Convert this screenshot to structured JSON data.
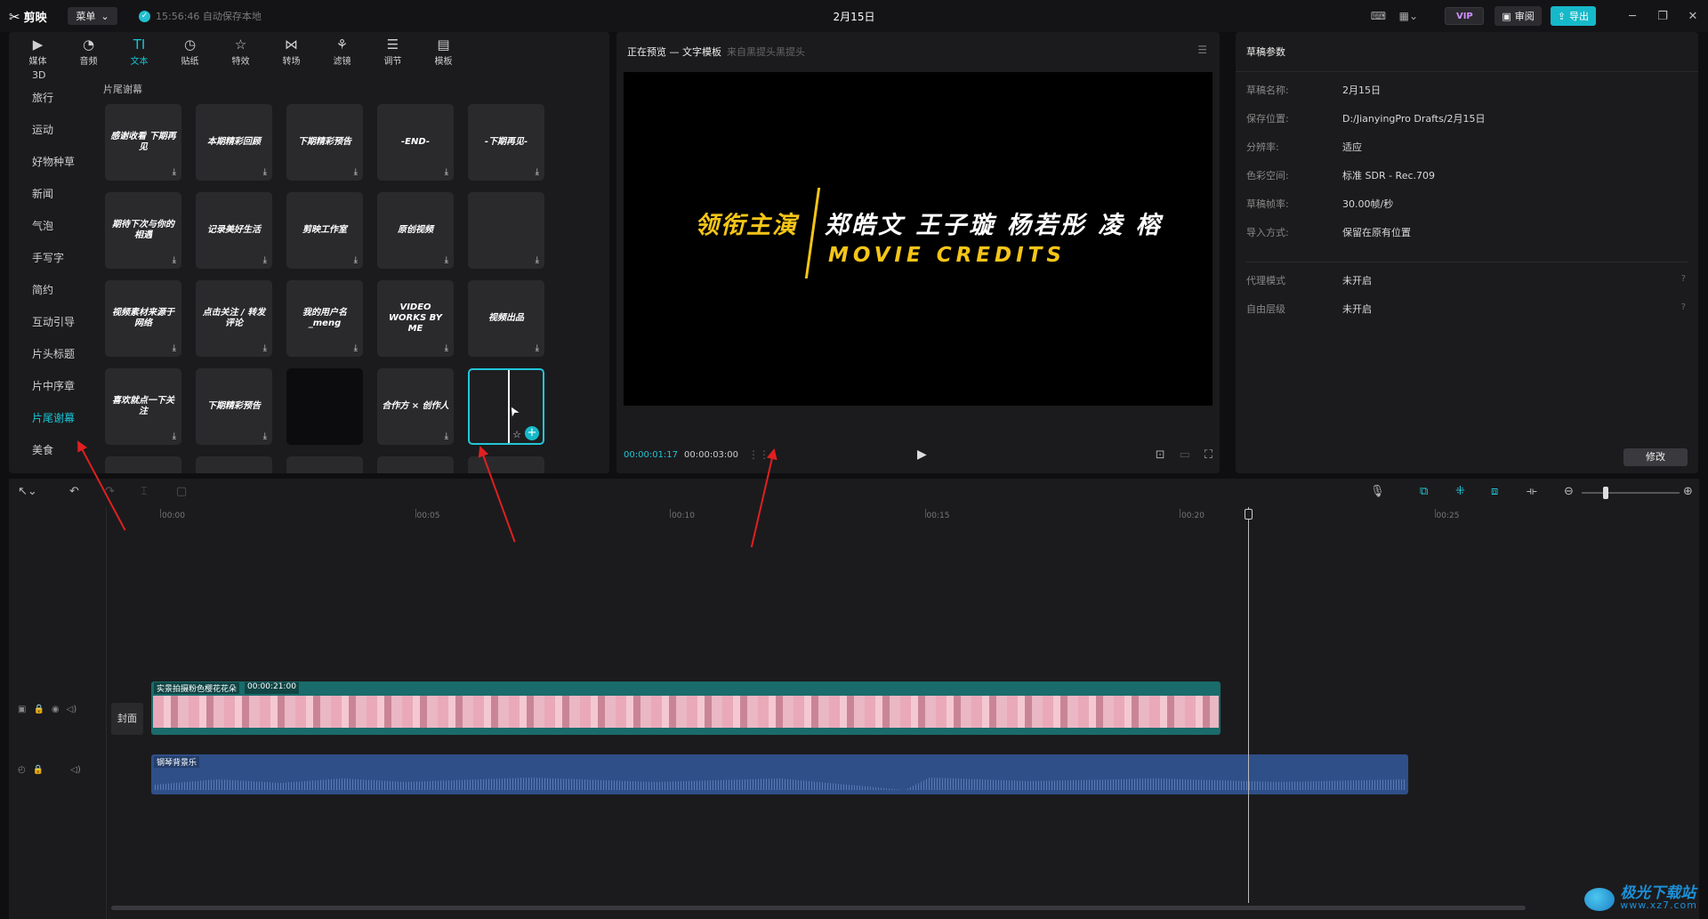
{
  "app": {
    "name": "剪映",
    "menu_label": "菜单",
    "save_status": "15:56:46 自动保存本地",
    "doc_title": "2月15日",
    "vip_label": "VIP",
    "review_label": "审阅",
    "export_label": "导出"
  },
  "tabs": [
    {
      "label": "媒体",
      "icon": "media-icon"
    },
    {
      "label": "音频",
      "icon": "audio-icon"
    },
    {
      "label": "文本",
      "icon": "text-icon"
    },
    {
      "label": "贴纸",
      "icon": "sticker-icon"
    },
    {
      "label": "特效",
      "icon": "effect-icon"
    },
    {
      "label": "转场",
      "icon": "transition-icon"
    },
    {
      "label": "滤镜",
      "icon": "filter-icon"
    },
    {
      "label": "调节",
      "icon": "adjust-icon"
    },
    {
      "label": "模板",
      "icon": "template-icon"
    }
  ],
  "categories": {
    "top_partial": "3D",
    "items": [
      "旅行",
      "运动",
      "好物种草",
      "新闻",
      "气泡",
      "手写字",
      "简约",
      "互动引导",
      "片头标题",
      "片中序章",
      "片尾谢幕",
      "美食"
    ],
    "active": "片尾谢幕"
  },
  "section_title": "片尾谢幕",
  "templates": [
    "感谢收看 下期再见",
    "本期精彩回顾",
    "下期精彩预告",
    "-END-",
    "-下期再见-",
    "期待下次与你的相遇",
    "记录美好生活",
    "剪映工作室",
    "原创视频",
    "",
    "视频素材来源于网络",
    "点击关注 / 转发评论",
    "我的用户名_meng",
    "VIDEO WORKS BY ME",
    "视频出品",
    "喜欢就点一下关注",
    "下期精彩预告",
    "",
    "合作方 × 创作人",
    ""
  ],
  "preview": {
    "title": "正在预览 — 文字模板",
    "subtitle": "来自黑提头黑提头",
    "role": "领衔主演",
    "names": "郑皓文 王子璇 杨若彤 凌 榕",
    "movie_credits": "MOVIE CREDITS",
    "time_current": "00:00:01:17",
    "time_total": "00:00:03:00"
  },
  "props": {
    "title": "草稿参数",
    "rows": [
      {
        "k": "草稿名称:",
        "v": "2月15日"
      },
      {
        "k": "保存位置:",
        "v": "D:/JianyingPro Drafts/2月15日"
      },
      {
        "k": "分辨率:",
        "v": "适应"
      },
      {
        "k": "色彩空间:",
        "v": "标准 SDR - Rec.709"
      },
      {
        "k": "草稿帧率:",
        "v": "30.00帧/秒"
      },
      {
        "k": "导入方式:",
        "v": "保留在原有位置"
      }
    ],
    "proxy_k": "代理模式",
    "proxy_v": "未开启",
    "layer_k": "自由层级",
    "layer_v": "未开启",
    "modify_label": "修改"
  },
  "timeline": {
    "ticks": [
      "00:00",
      "00:05",
      "00:10",
      "00:15",
      "00:20",
      "00:25"
    ],
    "video_clip_name": "实景拍摄粉色樱花花朵",
    "video_clip_duration": "00:00:21:00",
    "cover_label": "封面",
    "audio_clip_name": "钢琴背景乐"
  },
  "watermark": {
    "cn": "极光下载站",
    "url": "www.xz7.com"
  }
}
